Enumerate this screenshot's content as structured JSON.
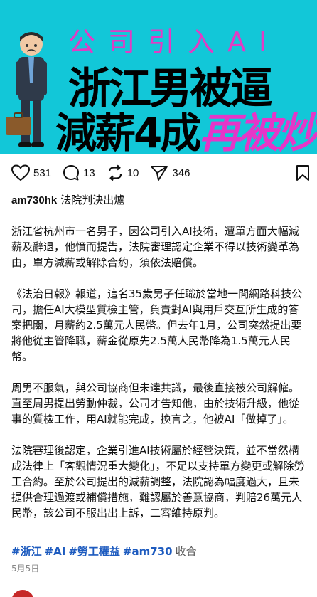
{
  "hero": {
    "subtitle": "公司引入AI",
    "line1": "浙江男被逼",
    "line2_black": "減薪4成",
    "line2_pink": "再被炒"
  },
  "actions": {
    "likes": "531",
    "comments": "13",
    "reposts": "10",
    "shares": "346"
  },
  "author": {
    "name": "am730hk",
    "title": "法院判決出爐"
  },
  "paragraphs": [
    "浙江省杭州市一名男子，因公司引入AI技術，遭單方面大幅減薪及辭退，他憤而提告，法院審理認定企業不得以技術變革為由，單方減薪或解除合約，須依法賠償。",
    "《法治日報》報道，這名35歲男子任職於當地一間網路科技公司，擔任AI大模型質檢主管，負責對AI與用戶交互所生成的答案把關，月薪約2.5萬元人民幣。但去年1月，公司突然提出要將他從主管降職，薪金從原先2.5萬人民幣降為1.5萬元人民幣。",
    "周男不服氣，與公司協商但未達共識，最後直接被公司解僱。直至周男提出勞動仲裁，公司才告知他，由於技術升級，他從事的質檢工作，用AI就能完成，換言之，他被AI「做掉了」。",
    "法院審理後認定，企業引進AI技術屬於經營決策，並不當然構成法律上「客觀情況重大變化」，不足以支持單方變更或解除勞工合約。至於公司提出的減薪調整，法院認為幅度過大，且未提供合理過渡或補償措施，難認屬於善意協商，判賠26萬元人民幣，該公司不服出出上訴，二審維持原判。"
  ],
  "tags": [
    "#浙江",
    "#AI",
    "#勞工權益",
    "#am730"
  ],
  "collect_label": "收合",
  "date": "5月5日",
  "colors": {
    "banner_bg": "#12c7d8",
    "accent_pink": "#e536c8",
    "tag_blue": "#1d5bbf"
  }
}
